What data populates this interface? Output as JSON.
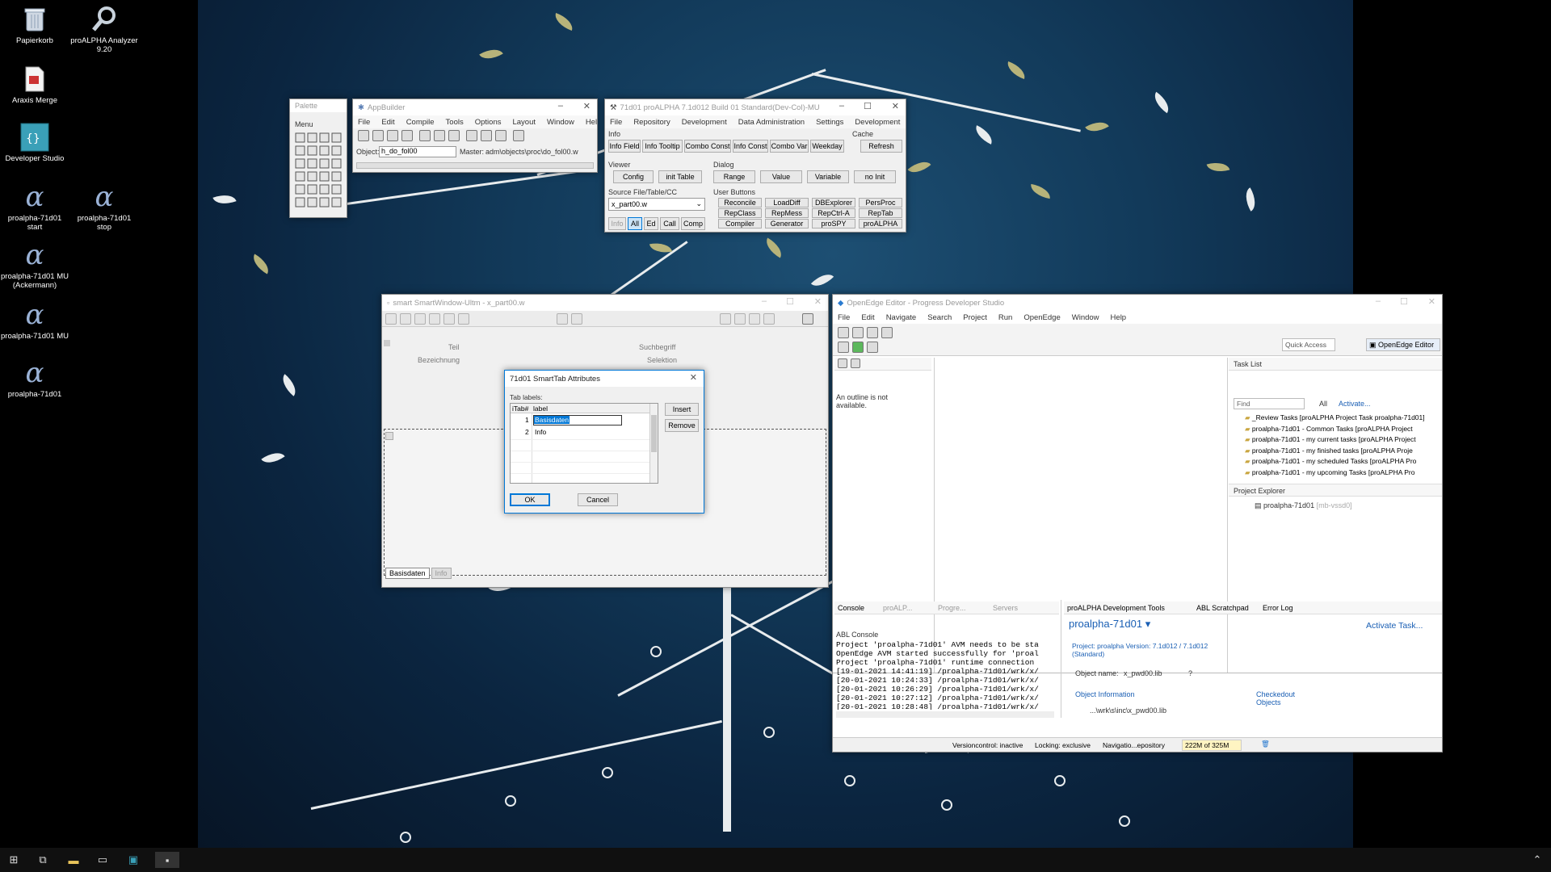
{
  "desktop": {
    "icons": [
      {
        "label": "Papierkorb",
        "glyph": "recycle-bin-icon"
      },
      {
        "label": "proALPHA Analyzer 9.20",
        "glyph": "analyzer-icon"
      },
      {
        "label": "Araxis Merge",
        "glyph": "document-icon"
      },
      {
        "label": "Developer Studio",
        "glyph": "developer-studio-icon"
      },
      {
        "label": "proalpha-71d01 start",
        "glyph": "proalpha-icon"
      },
      {
        "label": "proalpha-71d01 stop",
        "glyph": "proalpha-icon"
      },
      {
        "label": "proalpha-71d01 MU (Ackermann)",
        "glyph": "proalpha-icon"
      },
      {
        "label": "proalpha-71d01 MU",
        "glyph": "proalpha-icon"
      },
      {
        "label": "proalpha-71d01",
        "glyph": "proalpha-icon"
      }
    ]
  },
  "palette": {
    "title": "Palette",
    "menu": "Menu"
  },
  "appbuilder": {
    "title": "AppBuilder",
    "menu": [
      "File",
      "Edit",
      "Compile",
      "Tools",
      "Options",
      "Layout",
      "Window",
      "Help"
    ],
    "object_label": "Object:",
    "object_value": "h_do_fol00",
    "master_label": "Master:",
    "master_value": "adm\\objects\\proc\\do_fol00.w"
  },
  "pa_tools": {
    "title": "71d01 proALPHA 7.1d012 Build 01 Standard(Dev-Col)-MU",
    "menu": [
      "File",
      "Repository",
      "Development",
      "Data Administration",
      "Settings",
      "Development"
    ],
    "info_label": "Info",
    "cache_label": "Cache",
    "row1": [
      "Info Field",
      "Info Tooltip",
      "Combo Const",
      "Info Const",
      "Combo Var",
      "Weekday"
    ],
    "refresh": "Refresh",
    "viewer_label": "Viewer",
    "dialog_label": "Dialog",
    "config": "Config",
    "init_table": "init Table",
    "row2": [
      "Range",
      "Value",
      "Variable",
      "no Init"
    ],
    "source_label": "Source File/Table/CC",
    "source_value": "x_part00.w",
    "user_buttons_label": "User Buttons",
    "source_btns": [
      "Info",
      "All",
      "Ed",
      "Call",
      "Comp"
    ],
    "user_buttons": [
      [
        "Reconcile",
        "LoadDiff",
        "DBExplorer",
        "PersProc"
      ],
      [
        "RepClass",
        "RepMess",
        "RepCtrl-A",
        "RepTab"
      ],
      [
        "Compiler",
        "Generator",
        "proSPY",
        "proALPHA"
      ]
    ]
  },
  "smartwindow": {
    "title": "smart SmartWindow-Ultm - x_part00.w",
    "teil": "Teil",
    "suchbegriff": "Suchbegriff",
    "bezeichnung": "Bezeichnung",
    "selektion": "Selektion",
    "tab_basis": "Basisdaten",
    "tab_info": "Info"
  },
  "dialog": {
    "title": "71d01 SmartTab Attributes",
    "tab_labels": "Tab labels:",
    "col_num": "iTab#",
    "col_label": "label",
    "rows": [
      {
        "num": "1",
        "label": "Basisdaten"
      },
      {
        "num": "2",
        "label": "Info"
      }
    ],
    "insert": "Insert",
    "remove": "Remove",
    "ok": "OK",
    "cancel": "Cancel"
  },
  "openedge": {
    "title": "OpenEdge Editor - Progress Developer Studio",
    "menu": [
      "File",
      "Edit",
      "Navigate",
      "Search",
      "Project",
      "Run",
      "OpenEdge",
      "Window",
      "Help"
    ],
    "quick_access": "Quick Access",
    "perspective": "OpenEdge Editor",
    "outline_msg": "An outline is not available.",
    "task_list": "Task List",
    "find": "Find",
    "all": "All",
    "activate": "Activate...",
    "tasks": [
      "_Review Tasks  [proALPHA Project Task proalpha-71d01]",
      "proalpha-71d01 - Common Tasks  [proALPHA Project",
      "proalpha-71d01 - my current tasks  [proALPHA Project",
      "proalpha-71d01 - my finished tasks  [proALPHA Proje",
      "proalpha-71d01 - my scheduled Tasks  [proALPHA Pro",
      "proalpha-71d01 - my upcoming Tasks  [proALPHA Pro"
    ],
    "project_explorer": "Project Explorer",
    "project_item": "proalpha-71d01",
    "project_item_suffix": "[mb-vssd0]",
    "console_tab": "Console",
    "other_tabs": [
      "proALP...",
      "Progre...",
      "Servers"
    ],
    "abl_console": "ABL Console",
    "console_lines": [
      "Project 'proalpha-71d01' AVM needs to be sta",
      "OpenEdge AVM started successfully for 'proal",
      "Project 'proalpha-71d01' runtime connection",
      "[19-01-2021 14:41:19] /proalpha-71d01/wrk/x/",
      "[20-01-2021 10:24:33] /proalpha-71d01/wrk/x/",
      "[20-01-2021 10:26:29] /proalpha-71d01/wrk/x/",
      "[20-01-2021 10:27:12] /proalpha-71d01/wrk/x/",
      "[20-01-2021 10:28:48] /proalpha-71d01/wrk/x/"
    ],
    "pa_dev_tools_tab": "proALPHA Development Tools",
    "scratchpad_tab": "ABL Scratchpad",
    "errorlog_tab": "Error Log",
    "pa_project": "proalpha-71d01",
    "activate_task": "Activate Task...",
    "project_line": "Project: proalpha Version: 7.1d012 / 7.1d012 (Standard)",
    "object_name_label": "Object name:",
    "object_name_value": "x_pwd00.lib",
    "question": "?",
    "object_information": "Object Information",
    "checkedout": "Checkedout Objects",
    "path_item": "...\\wrk\\s\\inc\\x_pwd00.lib",
    "status": [
      "Versioncontrol: inactive",
      "Locking: exclusive",
      "Navigatio...epository"
    ],
    "memory": "222M of 325M"
  },
  "colors": {
    "wallpaper": "#123a5a",
    "selection": "#0078d7",
    "accent_blue": "#1a5fb4"
  }
}
